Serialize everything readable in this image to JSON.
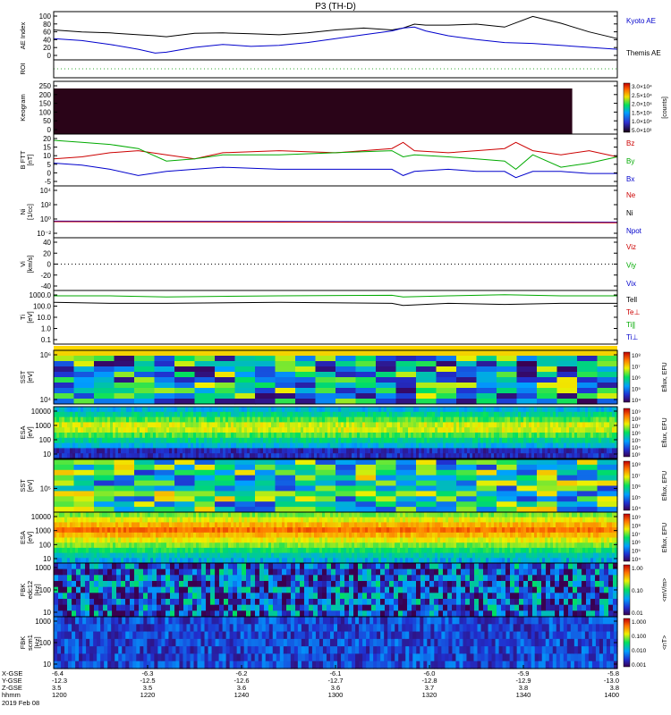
{
  "chart_data": {
    "type": "line",
    "title": "P3 (TH-D)",
    "panels": [
      {
        "id": "ae",
        "ylabel": [
          "AE Index"
        ],
        "yticks": [
          "100",
          "80",
          "60",
          "40",
          "20",
          "0"
        ],
        "legend": [
          {
            "label": "Kyoto AE",
            "color": "#0000cc"
          },
          {
            "label": "Themis AE",
            "color": "#000000"
          }
        ],
        "series": [
          {
            "name": "Themis AE",
            "color": "#000000",
            "x": [
              0,
              5,
              10,
              15,
              18,
              20,
              25,
              30,
              35,
              40,
              45,
              50,
              55,
              60,
              62,
              64,
              66,
              70,
              75,
              80,
              85,
              90,
              95,
              100
            ],
            "values": [
              62,
              58,
              56,
              52,
              50,
              48,
              55,
              56,
              54,
              52,
              56,
              62,
              66,
              62,
              66,
              74,
              72,
              72,
              74,
              68,
              90,
              76,
              58,
              44
            ]
          },
          {
            "name": "Kyoto AE",
            "color": "#0000cc",
            "x": [
              0,
              5,
              10,
              15,
              18,
              20,
              25,
              30,
              35,
              40,
              45,
              50,
              55,
              60,
              62,
              64,
              66,
              70,
              75,
              80,
              85,
              90,
              95,
              100
            ],
            "values": [
              44,
              40,
              32,
              22,
              14,
              16,
              26,
              32,
              28,
              30,
              36,
              44,
              52,
              60,
              66,
              68,
              60,
              50,
              42,
              36,
              34,
              30,
              26,
              22
            ]
          }
        ]
      },
      {
        "id": "roi",
        "ylabel": [
          "ROI"
        ],
        "yticks": [],
        "series": [
          {
            "name": "",
            "color": "#33aa33",
            "style": "dotted",
            "x": [
              0,
              100
            ],
            "values": [
              0.5,
              0.5
            ]
          }
        ]
      },
      {
        "id": "keogram",
        "ylabel": [
          "Keogram"
        ],
        "yticks": [
          "250",
          "200",
          "150",
          "100",
          "50",
          "0"
        ],
        "colorbar": {
          "ticks": [
            "3.0×10⁴",
            "2.5×10⁴",
            "2.0×10⁴",
            "1.5×10⁴",
            "1.0×10⁴",
            "5.0×10³"
          ],
          "label": "[counts]",
          "colors": [
            "#1a0010",
            "#4a0060",
            "#2020c0",
            "#00a0ff",
            "#00e060",
            "#f0e000",
            "#ff6000",
            "#c00000"
          ]
        },
        "fill_color": "#2a0418",
        "fill_extent_x": [
          0,
          92
        ]
      },
      {
        "id": "bfield",
        "ylabel": [
          "B FTT",
          "[nT]"
        ],
        "yticks": [
          "20",
          "15",
          "10",
          "5",
          "0",
          "-5"
        ],
        "ylim": [
          -5,
          20
        ],
        "legend": [
          {
            "label": "Bz",
            "color": "#cc0000"
          },
          {
            "label": "By",
            "color": "#00aa00"
          },
          {
            "label": "Bx",
            "color": "#0000cc"
          }
        ],
        "series": [
          {
            "name": "Bz",
            "color": "#cc0000",
            "x": [
              0,
              5,
              10,
              15,
              20,
              25,
              30,
              40,
              50,
              60,
              62,
              64,
              70,
              75,
              80,
              82,
              85,
              90,
              95,
              100
            ],
            "values": [
              8,
              9,
              11,
              12,
              10,
              8,
              11,
              12,
              11,
              13,
              16,
              12,
              11,
              12,
              13,
              16,
              12,
              10,
              12,
              9
            ]
          },
          {
            "name": "By",
            "color": "#00aa00",
            "x": [
              0,
              5,
              10,
              15,
              20,
              25,
              30,
              40,
              50,
              60,
              62,
              64,
              70,
              75,
              80,
              82,
              85,
              90,
              95,
              100
            ],
            "values": [
              17,
              16,
              15,
              13,
              7,
              8,
              10,
              10,
              11,
              12,
              9,
              10,
              9,
              8,
              7,
              3,
              10,
              4,
              6,
              9
            ]
          },
          {
            "name": "Bx",
            "color": "#0000cc",
            "x": [
              0,
              5,
              10,
              15,
              20,
              25,
              30,
              40,
              50,
              60,
              62,
              64,
              70,
              75,
              80,
              82,
              85,
              90,
              95,
              100
            ],
            "values": [
              6,
              5,
              3,
              0,
              2,
              3,
              4,
              3,
              3,
              3,
              0,
              2,
              3,
              2,
              2,
              -1,
              2,
              2,
              1,
              1
            ]
          }
        ]
      },
      {
        "id": "density",
        "ylabel": [
          "Ni",
          "[1/cc]"
        ],
        "yticks": [
          "10⁴",
          "10²",
          "10⁰",
          "10⁻²"
        ],
        "legend": [
          {
            "label": "Ne",
            "color": "#cc0000"
          },
          {
            "label": "Ni",
            "color": "#000000"
          },
          {
            "label": "Npot",
            "color": "#0000cc"
          }
        ],
        "series": [
          {
            "name": "Ni",
            "color": "#0000cc",
            "x": [
              0,
              100
            ],
            "values": [
              0.32,
              0.3
            ]
          },
          {
            "name": "Ne",
            "color": "#cc0000",
            "x": [
              0,
              100
            ],
            "values": [
              0.31,
              0.29
            ]
          }
        ]
      },
      {
        "id": "velocity",
        "ylabel": [
          "Vi",
          "[km/s]"
        ],
        "yticks": [
          "40",
          "20",
          "0",
          "-20",
          "-40"
        ],
        "legend": [
          {
            "label": "Viz",
            "color": "#cc0000"
          },
          {
            "label": "Viy",
            "color": "#00aa00"
          },
          {
            "label": "Vix",
            "color": "#0000cc"
          }
        ],
        "series": [
          {
            "name": "zero",
            "color": "#000000",
            "style": "dotted",
            "x": [
              0,
              100
            ],
            "values": [
              0.5,
              0.5
            ]
          }
        ]
      },
      {
        "id": "temperature",
        "ylabel": [
          "Ti",
          "[eV]"
        ],
        "yticks": [
          "1000.0",
          "100.0",
          "10.0",
          "1.0",
          "0.1"
        ],
        "legend": [
          {
            "label": "Tell",
            "color": "#000000"
          },
          {
            "label": "Te⊥",
            "color": "#cc0000"
          },
          {
            "label": "Ti∥",
            "color": "#00aa00"
          },
          {
            "label": "Ti⊥",
            "color": "#0000cc"
          }
        ],
        "series": [
          {
            "name": "Ti∥",
            "color": "#00aa00",
            "x": [
              0,
              10,
              20,
              40,
              60,
              62,
              70,
              80,
              90,
              100
            ],
            "values": [
              0.9,
              0.9,
              0.88,
              0.9,
              0.91,
              0.88,
              0.9,
              0.92,
              0.9,
              0.9
            ]
          },
          {
            "name": "Tell",
            "color": "#000000",
            "x": [
              0,
              10,
              20,
              40,
              60,
              62,
              70,
              80,
              90,
              100
            ],
            "values": [
              0.78,
              0.76,
              0.76,
              0.78,
              0.76,
              0.72,
              0.76,
              0.74,
              0.76,
              0.76
            ]
          }
        ]
      },
      {
        "id": "sst1",
        "ylabel": [
          "SST",
          "[eV]"
        ],
        "yticks": [
          "10⁶",
          "10⁴"
        ],
        "colorbar": {
          "ticks": [
            "10⁸",
            "10⁷",
            "10⁶",
            "10⁵",
            "10⁴"
          ],
          "label": "Eflux, EFU"
        }
      },
      {
        "id": "esa1",
        "ylabel": [
          "ESA",
          "[eV]"
        ],
        "yticks": [
          "10000",
          "1000",
          "100",
          "10"
        ],
        "colorbar": {
          "ticks": [
            "10⁹",
            "10⁸",
            "10⁷",
            "10⁶",
            "10⁵",
            "10⁴",
            "10³"
          ],
          "label": "Eflux, EFU"
        }
      },
      {
        "id": "sst2",
        "ylabel": [
          "SST",
          "[eV]"
        ],
        "yticks": [
          "10⁵"
        ],
        "colorbar": {
          "ticks": [
            "10⁸",
            "10⁷",
            "10⁶",
            "10⁵",
            "10⁴"
          ],
          "label": "Eflux, EFU"
        }
      },
      {
        "id": "esa2",
        "ylabel": [
          "ESA",
          "[eV]"
        ],
        "yticks": [
          "10000",
          "1000",
          "100",
          "10"
        ],
        "colorbar": {
          "ticks": [
            "10⁹",
            "10⁸",
            "10⁷",
            "10⁶",
            "10⁵",
            "10⁴"
          ],
          "label": "Eflux, EFU"
        }
      },
      {
        "id": "fbk_e",
        "ylabel": [
          "FBK",
          "edc12",
          "[Hz]"
        ],
        "yticks": [
          "1000",
          "100",
          "10"
        ],
        "colorbar": {
          "ticks": [
            "1.00",
            "0.10",
            "0.01"
          ],
          "label": "<mV/m>"
        }
      },
      {
        "id": "fbk_b",
        "ylabel": [
          "FBK",
          "scm1",
          "[Hz]"
        ],
        "yticks": [
          "1000",
          "100",
          "10"
        ],
        "colorbar": {
          "ticks": [
            "1.000",
            "0.100",
            "0.010",
            "0.001"
          ],
          "label": "<nT>"
        }
      }
    ],
    "xaxis": {
      "row_labels": [
        "X-GSE",
        "Y-GSE",
        "Z-GSE",
        "hhmm",
        "2019 Feb 08"
      ],
      "columns": [
        [
          "-6.4",
          "-12.3",
          "3.5",
          "1200"
        ],
        [
          "-6.3",
          "-12.5",
          "3.5",
          "1220"
        ],
        [
          "-6.2",
          "-12.6",
          "3.6",
          "1240"
        ],
        [
          "-6.1",
          "-12.7",
          "3.6",
          "1300"
        ],
        [
          "-6.0",
          "-12.8",
          "3.7",
          "1320"
        ],
        [
          "-5.9",
          "-12.9",
          "3.8",
          "1340"
        ],
        [
          "-5.8",
          "-13.0",
          "3.8",
          "1400"
        ]
      ]
    }
  }
}
